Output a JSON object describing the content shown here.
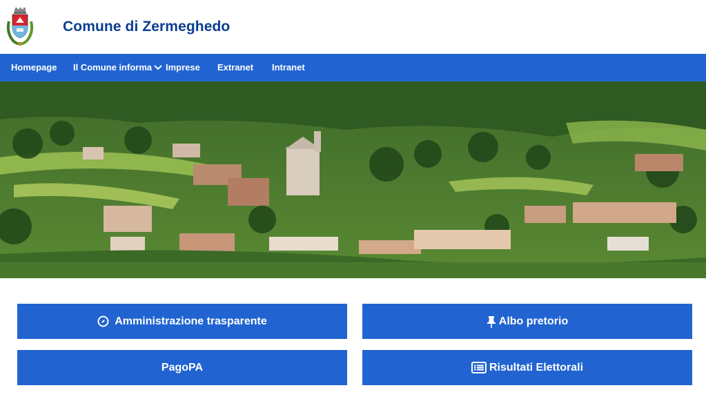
{
  "site": {
    "title": "Comune di Zermeghedo",
    "logo_icon": "municipal-coat-of-arms"
  },
  "nav": {
    "items": [
      {
        "label": "Homepage"
      },
      {
        "label": "Il Comune informa",
        "has_dropdown": true
      },
      {
        "label": "Imprese"
      },
      {
        "label": "Extranet"
      },
      {
        "label": "Intranet"
      }
    ]
  },
  "hero": {
    "image": "landscape-village-hillside"
  },
  "quick_links": [
    {
      "label": "Amministrazione trasparente",
      "icon": "compass-icon"
    },
    {
      "label": "Albo pretorio",
      "icon": "pushpin-icon"
    },
    {
      "label": "PagoPA",
      "icon": ""
    },
    {
      "label": "Risultati Elettorali",
      "icon": "list-icon"
    }
  ],
  "colors": {
    "primary": "#2164d1",
    "title": "#0b3d91"
  }
}
